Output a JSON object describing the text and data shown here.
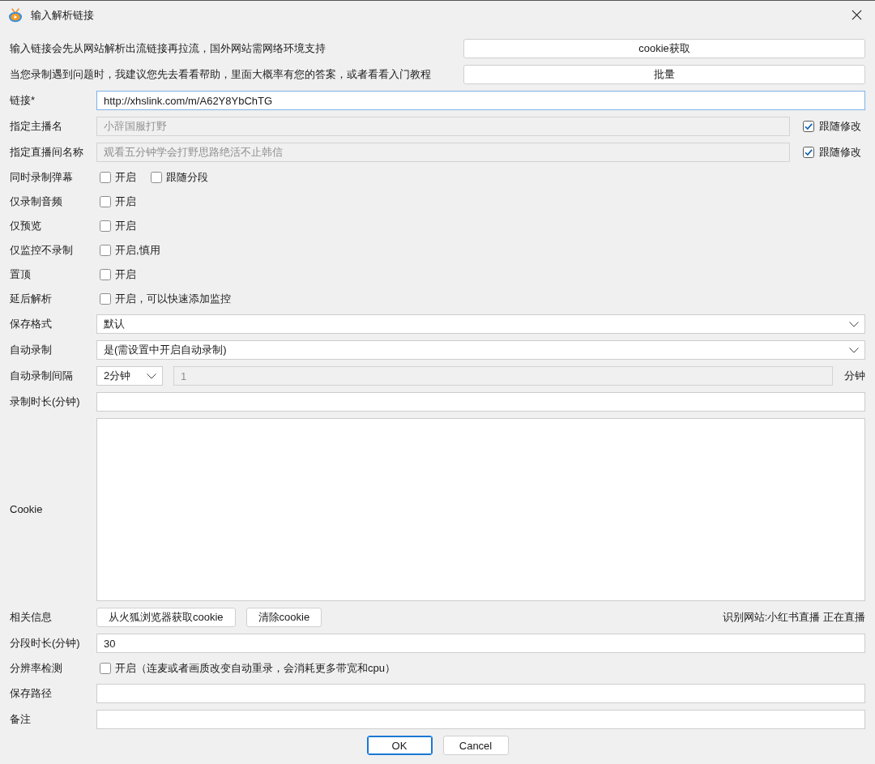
{
  "window": {
    "title": "输入解析链接"
  },
  "notices": [
    {
      "text": "输入链接会先从网站解析出流链接再拉流，国外网站需网络环境支持",
      "button": "cookie获取"
    },
    {
      "text": "当您录制遇到问题时，我建议您先去看看帮助，里面大概率有您的答案，或者看看入门教程",
      "button": "批量"
    }
  ],
  "fields": [
    {
      "kind": "input",
      "label": "链接*",
      "value": "http://xhslink.com/m/A62Y8YbChTG",
      "focused": true,
      "disabled": false
    },
    {
      "kind": "input",
      "label": "指定主播名",
      "value": "小辞国服打野",
      "focused": false,
      "disabled": true,
      "follow": {
        "label": "跟随修改",
        "checked": true
      }
    },
    {
      "kind": "input",
      "label": "指定直播间名称",
      "value": "观看五分钟学会打野思路绝活不止韩信",
      "focused": false,
      "disabled": true,
      "follow": {
        "label": "跟随修改",
        "checked": true
      }
    },
    {
      "kind": "checks",
      "label": "同时录制弹幕",
      "options": [
        {
          "label": "开启",
          "checked": false
        },
        {
          "label": "跟随分段",
          "checked": false
        }
      ]
    },
    {
      "kind": "checks",
      "label": "仅录制音频",
      "options": [
        {
          "label": "开启",
          "checked": false
        }
      ]
    },
    {
      "kind": "checks",
      "label": "仅预览",
      "options": [
        {
          "label": "开启",
          "checked": false
        }
      ]
    },
    {
      "kind": "checks",
      "label": "仅监控不录制",
      "options": [
        {
          "label": "开启,慎用",
          "checked": false
        }
      ]
    },
    {
      "kind": "checks",
      "label": "置顶",
      "options": [
        {
          "label": "开启",
          "checked": false
        }
      ]
    },
    {
      "kind": "checks",
      "label": "延后解析",
      "options": [
        {
          "label": "开启，可以快速添加监控",
          "checked": false
        }
      ]
    },
    {
      "kind": "select",
      "label": "保存格式",
      "value": "默认"
    },
    {
      "kind": "select",
      "label": "自动录制",
      "value": "是(需设置中开启自动录制)"
    },
    {
      "kind": "interval",
      "label": "自动录制间隔",
      "choice": "2分钟",
      "value": "1",
      "disabled": true,
      "unit": "分钟"
    },
    {
      "kind": "input",
      "label": "录制时长(分钟)",
      "focused": false,
      "disabled": false
    },
    {
      "kind": "textarea",
      "label": "Cookie"
    },
    {
      "kind": "actions",
      "label": "相关信息",
      "buttons": [
        "从火狐浏览器获取cookie",
        "清除cookie"
      ],
      "status": "识别网站:小红书直播 正在直播"
    },
    {
      "kind": "input",
      "label": "分段时长(分钟)",
      "value": "30",
      "focused": false,
      "disabled": false
    },
    {
      "kind": "checks",
      "label": "分辨率检测",
      "options": [
        {
          "label": "开启（连麦或者画质改变自动重录，会消耗更多带宽和cpu）",
          "checked": false
        }
      ]
    },
    {
      "kind": "input",
      "label": "保存路径",
      "focused": false,
      "disabled": false
    },
    {
      "kind": "input",
      "label": "备注",
      "focused": false,
      "disabled": false
    }
  ],
  "buttons": [
    {
      "label": "OK",
      "default": true
    },
    {
      "label": "Cancel",
      "default": false
    }
  ]
}
